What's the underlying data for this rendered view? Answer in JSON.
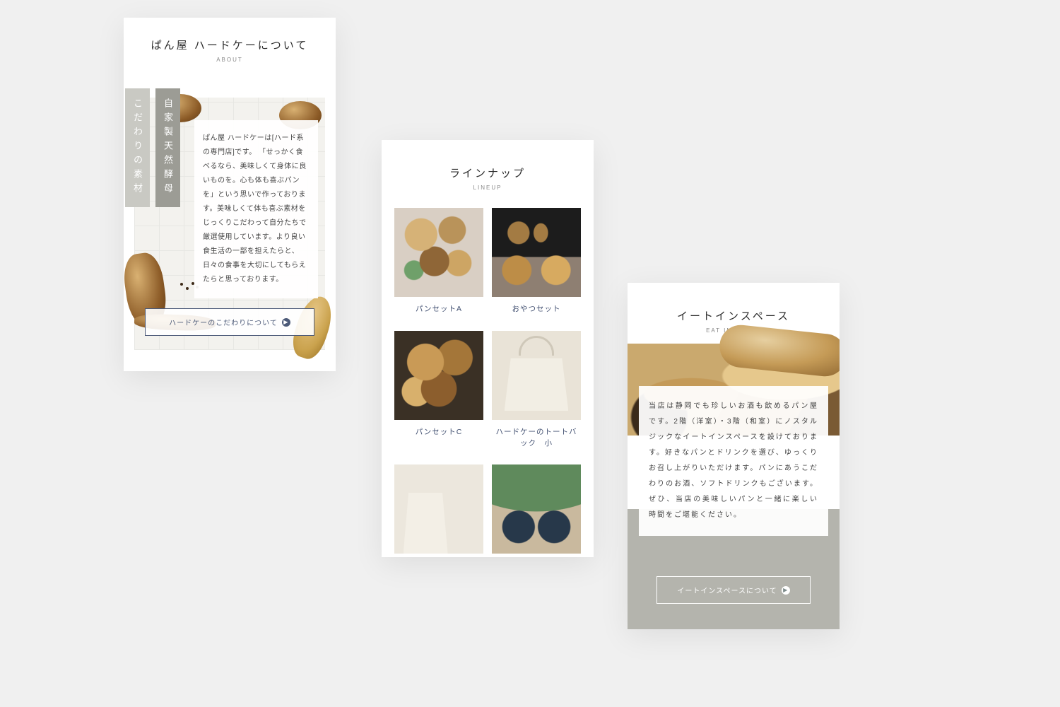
{
  "about": {
    "title": "ぱん屋 ハードケーについて",
    "subtitle": "ABOUT",
    "vertical_front": "自家製天然酵母",
    "vertical_back": "こだわりの素材",
    "body": "ぱん屋 ハードケーは[ハード系の専門店]です。\n「せっかく食べるなら、美味しくて身体に良いものを。心も体も喜ぶパンを」という思いで作っております。美味しくて体も喜ぶ素材をじっくりこだわって自分たちで厳選使用しています。より良い食生活の一部を担えたらと、日々の食事を大切にしてもらえたらと思っております。",
    "button_label": "ハードケーのこだわりについて"
  },
  "lineup": {
    "title": "ラインナップ",
    "subtitle": "LINEUP",
    "items": [
      {
        "name": "パンセットA"
      },
      {
        "name": "おやつセット"
      },
      {
        "name": "パンセットC"
      },
      {
        "name": "ハードケーのトートバック　小"
      },
      {
        "name": ""
      },
      {
        "name": ""
      }
    ]
  },
  "eatin": {
    "title": "イートインスペース",
    "subtitle": "EAT IN SPACE",
    "body": "当店は静岡でも珍しいお酒も飲めるパン屋です。2階（洋室）・3階（和室）にノスタルジックなイートインスペースを設けております。好きなパンとドリンクを選び、ゆっくりお召し上がりいただけます。パンにあうこだわりのお酒、ソフトドリンクもございます。ぜひ、当店の美味しいパンと一緒に楽しい時間をご堪能ください。",
    "button_label": "イートインスペースについて"
  }
}
